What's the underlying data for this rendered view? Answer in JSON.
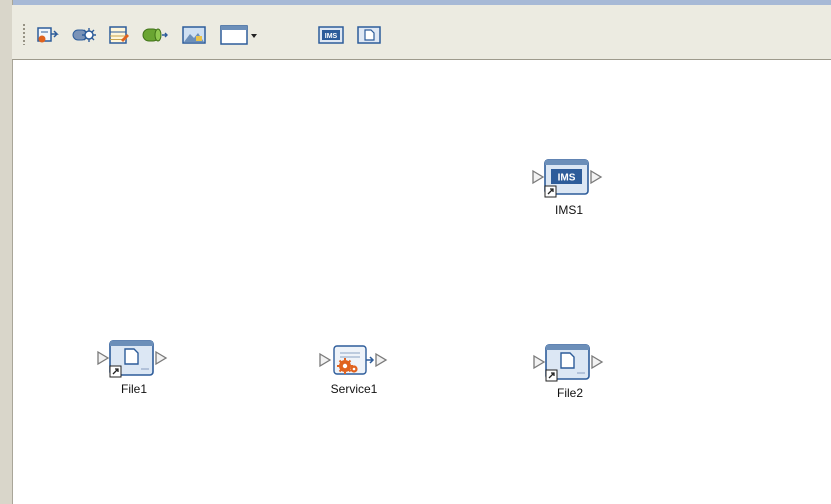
{
  "toolbar": {
    "buttons": [
      {
        "name": "add-inbound-adapter",
        "icon": "file-arrow-icon"
      },
      {
        "name": "add-web-service",
        "icon": "gear-connector-icon"
      },
      {
        "name": "add-table",
        "icon": "table-icon"
      },
      {
        "name": "add-connector",
        "icon": "cylinder-connector-icon"
      },
      {
        "name": "add-image",
        "icon": "picture-icon"
      },
      {
        "name": "window-dropdown",
        "icon": "window-dropdown-icon"
      },
      {
        "name": "add-ims",
        "icon": "ims-icon",
        "label": "IMS"
      },
      {
        "name": "add-file",
        "icon": "file-icon"
      }
    ]
  },
  "canvas": {
    "nodes": {
      "ims1": {
        "label": "IMS1",
        "badge": "IMS"
      },
      "file1": {
        "label": "File1"
      },
      "service1": {
        "label": "Service1"
      },
      "file2": {
        "label": "File2"
      }
    }
  },
  "colors": {
    "toolbar_bg": "#ecebe1",
    "frame_top": "#a7b9d6",
    "icon_blue": "#2d5c9a",
    "icon_orange": "#e0621e",
    "icon_green": "#5a9a2a"
  }
}
